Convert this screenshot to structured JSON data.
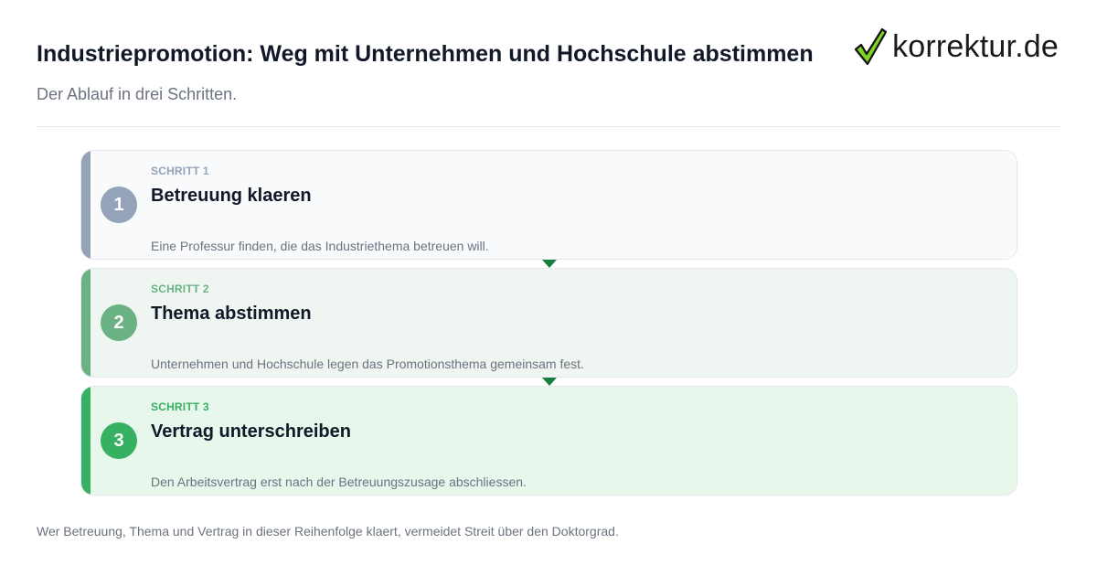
{
  "header": {
    "title": "Industriepromotion: Weg mit Unternehmen und Hochschule abstimmen",
    "subtitle": "Der Ablauf in drei Schritten.",
    "logo_text": "korrektur.de",
    "logo_icon": "checkmark-icon"
  },
  "steps": [
    {
      "number": "1",
      "label": "SCHRITT 1",
      "heading": "Betreuung klaeren",
      "description": "Eine Professur finden, die das Industriethema betreuen will.",
      "color": "#94a3b8"
    },
    {
      "number": "2",
      "label": "SCHRITT 2",
      "heading": "Thema abstimmen",
      "description": "Unternehmen und Hochschule legen das Promotionsthema gemeinsam fest.",
      "color": "#6ab283"
    },
    {
      "number": "3",
      "label": "SCHRITT 3",
      "heading": "Vertrag unterschreiben",
      "description": "Den Arbeitsvertrag erst nach der Betreuungszusage abschliessen.",
      "color": "#36b062"
    }
  ],
  "connector_color": "#15803d",
  "footer": {
    "note": "Wer Betreuung, Thema und Vertrag in dieser Reihenfolge klaert, vermeidet Streit über den Doktorgrad."
  }
}
